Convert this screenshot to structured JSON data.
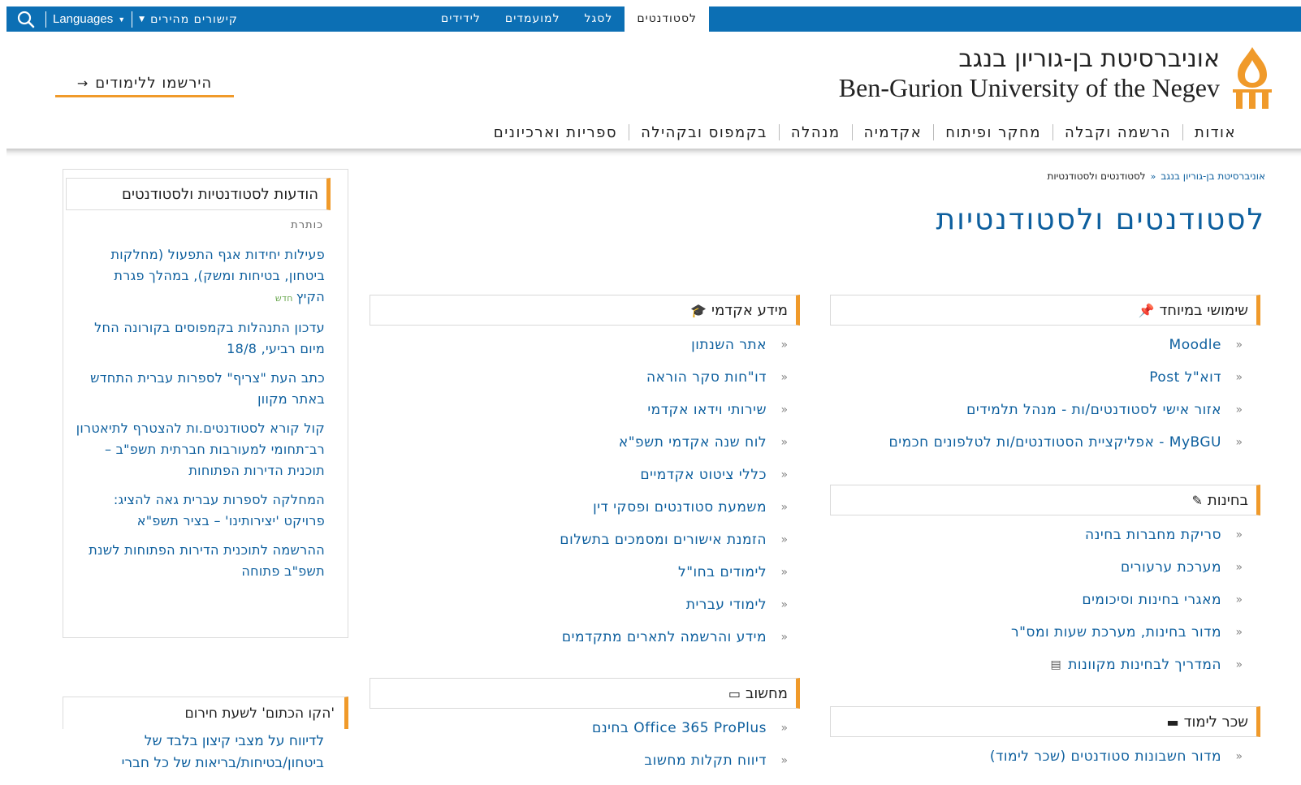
{
  "topbar": {
    "tabs": [
      "לסטודנטים",
      "לסגל",
      "למועמדים",
      "לידידים"
    ],
    "active_tab": "לסטודנטים",
    "languages_label": "Languages",
    "quick_links_label": "קישורים מהירים",
    "search_icon": "search-icon"
  },
  "header": {
    "logo_he": "אוניברסיטת בן-גוריון בנגב",
    "logo_en": "Ben-Gurion University of the Negev",
    "register_label": "הירשמו ללימודים"
  },
  "mainnav": [
    "אודות",
    "הרשמה וקבלה",
    "מחקר ופיתוח",
    "אקדמיה",
    "מנהלה",
    "בקמפוס ובקהילה",
    "ספריות וארכיונים"
  ],
  "breadcrumb": {
    "home": "אוניברסיטת בן-גוריון בנגב",
    "current": "לסטודנטים ולסטודנטיות"
  },
  "page_title": "לסטודנטים ולסטודנטיות",
  "useful": {
    "title": "שימושי במיוחד",
    "icon": "pin-icon",
    "links": [
      "Moodle",
      "דוא\"ל Post",
      "אזור אישי לסטודנטים/ות - מנהל תלמידים",
      "MyBGU - אפליקציית הסטודנטים/ות לטלפונים חכמים"
    ]
  },
  "exams": {
    "title": "בחינות",
    "icon": "pen-icon",
    "links": [
      "סריקת מחברות בחינה",
      "מערכת ערעורים",
      "מאגרי בחינות וסיכומים",
      "מדור בחינות, מערכת שעות ומס\"ר",
      "המדריך לבחינות מקוונות"
    ]
  },
  "tuition": {
    "title": "שכר לימוד",
    "icon": "card-icon",
    "links": [
      "מדור חשבונות סטודנטים (שכר לימוד)"
    ]
  },
  "academic": {
    "title": "מידע אקדמי",
    "icon": "graduation-icon",
    "links": [
      "אתר השנתון",
      "דו\"חות סקר הוראה",
      "שירותי וידאו אקדמי",
      "לוח שנה אקדמי תשפ\"א",
      "כללי ציטוט אקדמיים",
      "משמעת סטודנטים ופסקי דין",
      "הזמנת אישורים ומסמכים בתשלום",
      "לימודים בחו\"ל",
      "לימודי עברית",
      "מידע והרשמה לתארים מתקדמים"
    ]
  },
  "computing": {
    "title": "מחשוב",
    "icon": "laptop-icon",
    "links": [
      "Office 365 ProPlus בחינם",
      "דיווח תקלות מחשוב"
    ]
  },
  "sidebar": {
    "title": "הודעות לסטודנטיות ולסטודנטים",
    "subtitle": "כותרת",
    "new_badge": "חדש",
    "news": [
      "פעילות יחידות אגף התפעול (מחלקות ביטחון, בטיחות ומשק), במהלך פגרת הקיץ",
      "עדכון התנהלות בקמפוסים בקורונה החל מיום רביעי, 18/8",
      "כתב העת \"צריף\" לספרות עברית התחדש באתר מקוון",
      "קול קורא לסטודנטים.ות להצטרף לתיאטרון רב־תחומי למעורבות חברתית תשפ\"ב – תוכנית הדירות הפתוחות",
      "המחלקה לספרות עברית גאה להציג: פרויקט 'יצירותינו' – בציר תשפ\"א",
      "ההרשמה לתוכנית הדירות הפתוחות לשנת תשפ\"ב פתוחה"
    ],
    "emergency_title": "'הקו הכתום' לשעת חירום",
    "emergency_text": "לדיווח על מצבי קיצון בלבד של ביטחון/בטיחות/בריאות של כל חברי"
  }
}
